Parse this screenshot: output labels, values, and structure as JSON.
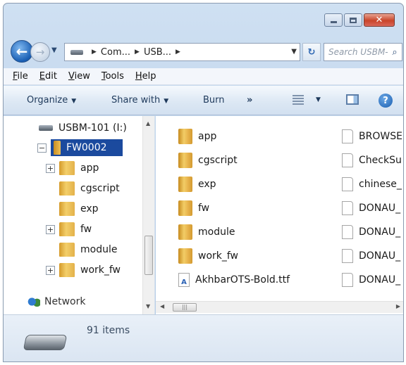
{
  "window": {
    "caption_buttons": [
      "minimize",
      "maximize",
      "close"
    ]
  },
  "address_bar": {
    "crumbs": [
      "Com...",
      "USB..."
    ],
    "search_placeholder": "Search USBM-..."
  },
  "menu": {
    "items": [
      {
        "label": "File",
        "underline": "F",
        "rest": "ile"
      },
      {
        "label": "Edit",
        "underline": "E",
        "rest": "dit"
      },
      {
        "label": "View",
        "underline": "V",
        "rest": "iew"
      },
      {
        "label": "Tools",
        "underline": "T",
        "rest": "ools"
      },
      {
        "label": "Help",
        "underline": "H",
        "rest": "elp"
      }
    ]
  },
  "command_bar": {
    "organize": "Organize",
    "share_with": "Share with",
    "burn": "Burn",
    "more": "»"
  },
  "nav_tree": {
    "drive": "USBM-101 (I:)",
    "selected_folder": "FW0002",
    "children": [
      {
        "label": "app",
        "expandable": true
      },
      {
        "label": "cgscript",
        "expandable": false
      },
      {
        "label": "exp",
        "expandable": false
      },
      {
        "label": "fw",
        "expandable": true
      },
      {
        "label": "module",
        "expandable": false
      },
      {
        "label": "work_fw",
        "expandable": true
      }
    ],
    "network": "Network",
    "expand_glyph": "+",
    "collapse_glyph": "−"
  },
  "content": {
    "col1": [
      {
        "name": "app",
        "kind": "folder"
      },
      {
        "name": "cgscript",
        "kind": "folder"
      },
      {
        "name": "exp",
        "kind": "folder"
      },
      {
        "name": "fw",
        "kind": "folder"
      },
      {
        "name": "module",
        "kind": "folder"
      },
      {
        "name": "work_fw",
        "kind": "folder"
      },
      {
        "name": "AkhbarOTS-Bold.ttf",
        "kind": "font"
      }
    ],
    "col2": [
      {
        "name": "BROWSE",
        "kind": "file"
      },
      {
        "name": "CheckSu",
        "kind": "file"
      },
      {
        "name": "chinese_",
        "kind": "file"
      },
      {
        "name": "DONAU_",
        "kind": "file"
      },
      {
        "name": "DONAU_",
        "kind": "file"
      },
      {
        "name": "DONAU_",
        "kind": "file"
      },
      {
        "name": "DONAU_",
        "kind": "file"
      }
    ]
  },
  "details": {
    "item_count": "91 items"
  },
  "colors": {
    "selection": "#1b4a9e",
    "frame": "#bcd2ea",
    "close_button": "#c9452a"
  }
}
